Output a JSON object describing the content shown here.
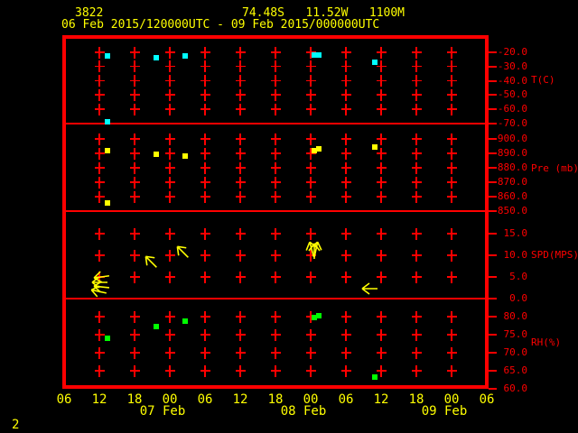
{
  "header": {
    "station_id": "3822",
    "position": "74.48S   11.52W   1100M",
    "time_range": "06 Feb 2015/120000UTC - 09 Feb 2015/000000UTC"
  },
  "page_indicator": "2",
  "colors": {
    "background": "#000000",
    "grid_red": "#ff0000",
    "label_yellow": "#ffff00",
    "temp_cyan": "#00ffff",
    "pressure_yellow": "#ffff00",
    "wind_yellow": "#ffff00",
    "rh_green": "#00ff00"
  },
  "x_axis": {
    "hour_labels": [
      "06",
      "12",
      "18",
      "00",
      "06",
      "12",
      "18",
      "00",
      "06",
      "12",
      "18",
      "00",
      "06"
    ],
    "date_labels": [
      {
        "label": "07 Feb",
        "tick_index": 3
      },
      {
        "label": "08 Feb",
        "tick_index": 7
      },
      {
        "label": "09 Feb",
        "tick_index": 11
      }
    ],
    "hours_per_tick": 6,
    "time_note": "t in data points = hours after first axis tick (06 UTC 06 Feb 2015)"
  },
  "chart_data": [
    {
      "type": "scatter",
      "panel": "temperature",
      "ylabel": "T(C)",
      "marker": "square",
      "marker_color": "#00ffff",
      "yticks": [
        {
          "label": "-20.0",
          "value": -20
        },
        {
          "label": "-30.0",
          "value": -30
        },
        {
          "label": "-40.0",
          "value": -40
        },
        {
          "label": "-50.0",
          "value": -50
        },
        {
          "label": "-60.0",
          "value": -60
        },
        {
          "label": "-70.0",
          "value": -70
        }
      ],
      "points": [
        {
          "t": 7.4,
          "v": -22.5
        },
        {
          "t": 15.7,
          "v": -23.5
        },
        {
          "t": 20.6,
          "v": -22.5
        },
        {
          "t": 42.6,
          "v": -21.9
        },
        {
          "t": 43.4,
          "v": -21.9
        },
        {
          "t": 52.9,
          "v": -27.0
        },
        {
          "t": 7.4,
          "v": -68.7
        }
      ]
    },
    {
      "type": "scatter",
      "panel": "pressure",
      "ylabel": "Pre (mb)",
      "marker": "square",
      "marker_color": "#ffff00",
      "yticks": [
        {
          "label": "900.0",
          "value": 900
        },
        {
          "label": "890.0",
          "value": 890
        },
        {
          "label": "880.0",
          "value": 880
        },
        {
          "label": "870.0",
          "value": 870
        },
        {
          "label": "860.0",
          "value": 860
        },
        {
          "label": "850.0",
          "value": 850
        }
      ],
      "points": [
        {
          "t": 7.4,
          "v": 891.8
        },
        {
          "t": 15.7,
          "v": 889.4
        },
        {
          "t": 20.6,
          "v": 888.1
        },
        {
          "t": 42.6,
          "v": 891.9
        },
        {
          "t": 43.4,
          "v": 893.1
        },
        {
          "t": 52.9,
          "v": 894.4
        },
        {
          "t": 7.4,
          "v": 855.6
        }
      ]
    },
    {
      "type": "scatter",
      "panel": "wind_speed",
      "ylabel": "SPD(MPS)",
      "marker": "arrow",
      "marker_color": "#ffff00",
      "rot_note": "rot = degrees clockwise; 0 = arrow pointing left",
      "yticks": [
        {
          "label": "15.0",
          "value": 15
        },
        {
          "label": "10.0",
          "value": 10
        },
        {
          "label": "5.0",
          "value": 5
        },
        {
          "label": "0.0",
          "value": 0
        }
      ],
      "arrows": [
        {
          "t": 6.3,
          "v": 5.0,
          "rot": -8
        },
        {
          "t": 6.0,
          "v": 3.8,
          "rot": 0
        },
        {
          "t": 6.3,
          "v": 2.7,
          "rot": 6
        },
        {
          "t": 5.8,
          "v": 1.6,
          "rot": 12
        },
        {
          "t": 14.8,
          "v": 8.5,
          "rot": 45
        },
        {
          "t": 20.2,
          "v": 10.9,
          "rot": 45
        },
        {
          "t": 42.2,
          "v": 11.5,
          "rot": 75
        },
        {
          "t": 42.6,
          "v": 11.1,
          "rot": 90
        },
        {
          "t": 42.9,
          "v": 11.4,
          "rot": 102
        },
        {
          "t": 52.0,
          "v": 2.3,
          "rot": 0
        }
      ]
    },
    {
      "type": "scatter",
      "panel": "relative_humidity",
      "ylabel": "RH(%)",
      "marker": "square",
      "marker_color": "#00ff00",
      "yticks": [
        {
          "label": "80.0",
          "value": 80
        },
        {
          "label": "75.0",
          "value": 75
        },
        {
          "label": "70.0",
          "value": 70
        },
        {
          "label": "65.0",
          "value": 65
        },
        {
          "label": "60.0",
          "value": 60
        }
      ],
      "points": [
        {
          "t": 7.4,
          "v": 73.9
        },
        {
          "t": 15.7,
          "v": 77.3
        },
        {
          "t": 20.6,
          "v": 78.8
        },
        {
          "t": 42.6,
          "v": 79.7
        },
        {
          "t": 43.4,
          "v": 80.3
        },
        {
          "t": 52.9,
          "v": 63.3
        }
      ]
    }
  ]
}
